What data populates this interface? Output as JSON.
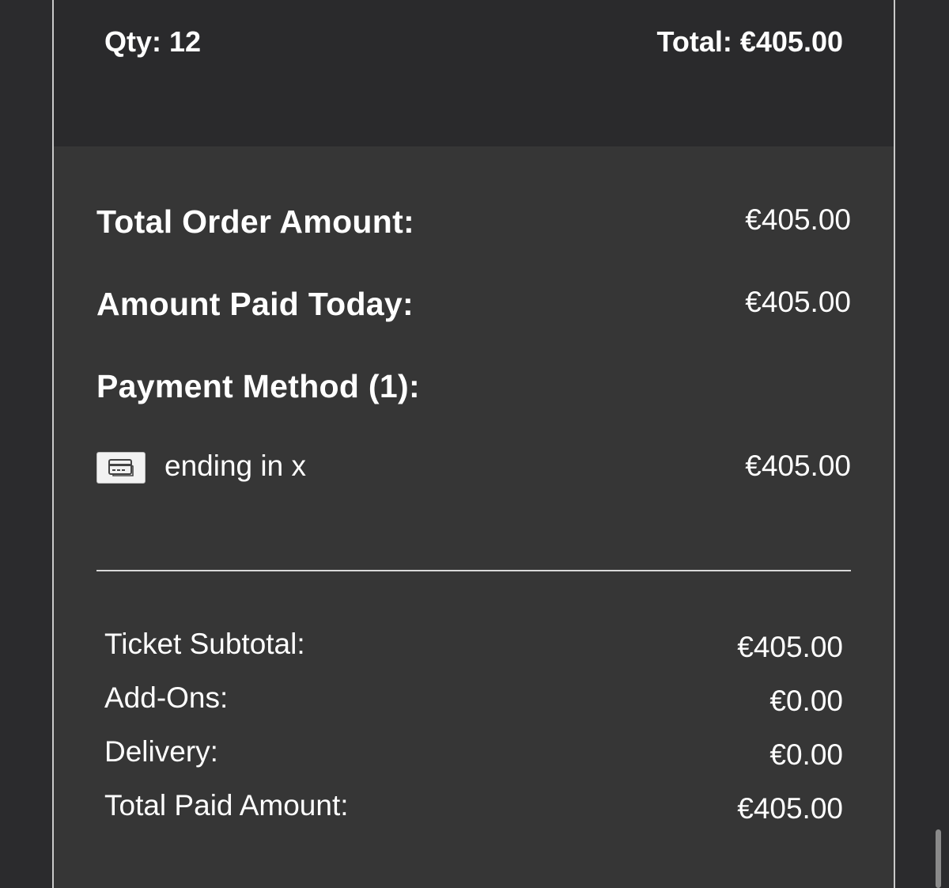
{
  "header": {
    "qty": "Qty: 12",
    "total": "Total: €405.00"
  },
  "summary": {
    "total_order_label": "Total Order Amount:",
    "total_order_value": "€405.00",
    "paid_today_label": "Amount Paid Today:",
    "paid_today_value": "€405.00",
    "payment_method_label": "Payment Method (1):"
  },
  "payment_method": {
    "icon": "credit-card-icon",
    "text": "ending in x",
    "amount": "€405.00"
  },
  "breakdown": [
    {
      "label": "Ticket Subtotal:",
      "value": "€405.00"
    },
    {
      "label": "Add-Ons:",
      "value": "€0.00"
    },
    {
      "label": "Delivery:",
      "value": "€0.00"
    },
    {
      "label": "Total Paid Amount:",
      "value": "€405.00"
    }
  ],
  "colors": {
    "background": "#2b2b2d",
    "panel_bottom": "#363636",
    "text": "#ffffff",
    "border": "#c9c9c9"
  }
}
